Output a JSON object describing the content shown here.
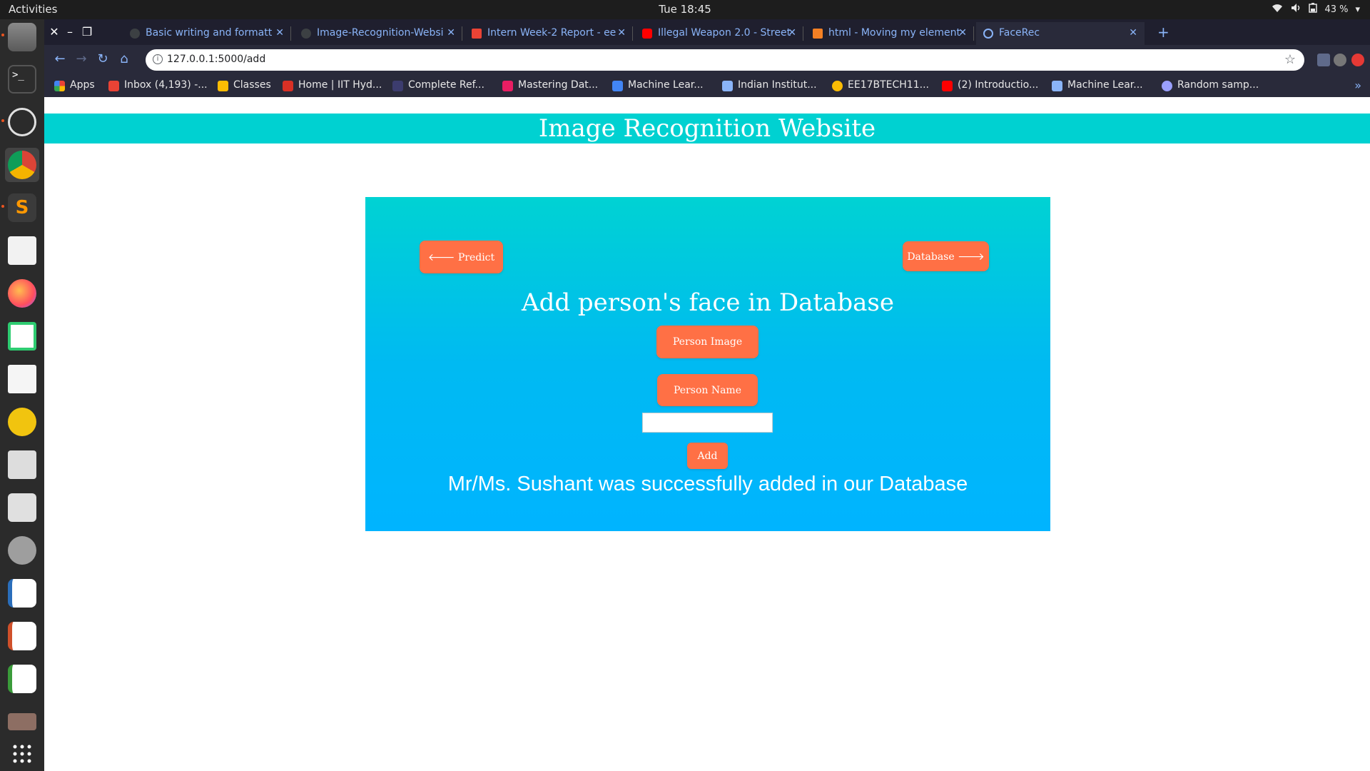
{
  "system": {
    "activities": "Activities",
    "clock": "Tue 18:45",
    "battery": "43 %"
  },
  "tabs": [
    {
      "title": "Basic writing and formatt",
      "icon_color": "#3c4043"
    },
    {
      "title": "Image-Recognition-Websi",
      "icon_color": "#3c4043"
    },
    {
      "title": "Intern Week-2 Report - ee",
      "icon_color": "#ea4335"
    },
    {
      "title": "Illegal Weapon 2.0 - Street",
      "icon_color": "#ff0000"
    },
    {
      "title": "html - Moving my element",
      "icon_color": "#f48024"
    },
    {
      "title": "FaceRec",
      "icon_color": "#8ab4f8"
    }
  ],
  "toolbar": {
    "url": "127.0.0.1:5000/add"
  },
  "bookmarks": [
    {
      "label": "Apps",
      "icon_color": "#ea4335"
    },
    {
      "label": "Inbox (4,193) -...",
      "icon_color": "#ea4335"
    },
    {
      "label": "Classes",
      "icon_color": "#fbbc04"
    },
    {
      "label": "Home | IIT Hyd...",
      "icon_color": "#d93025"
    },
    {
      "label": "Complete Ref...",
      "icon_color": "#3c3c6e"
    },
    {
      "label": "Mastering Dat...",
      "icon_color": "#e91e63"
    },
    {
      "label": "Machine Lear...",
      "icon_color": "#4285f4"
    },
    {
      "label": "Indian Institut...",
      "icon_color": "#8ab4f8"
    },
    {
      "label": "EE17BTECH11...",
      "icon_color": "#fbbc04"
    },
    {
      "label": "(2) Introductio...",
      "icon_color": "#ff0000"
    },
    {
      "label": "Machine Lear...",
      "icon_color": "#8ab4f8"
    },
    {
      "label": "Random samp...",
      "icon_color": "#9aa0ff"
    }
  ],
  "page": {
    "header": "Image Recognition Website",
    "predict_label": "🡐 Predict",
    "database_label": "Database 🡒",
    "title": "Add person's face in Database",
    "image_label": "Person Image",
    "name_label": "Person Name",
    "name_value": "",
    "add_label": "Add",
    "success": "Mr/Ms. Sushant was successfully added in our Database"
  },
  "colors": {
    "header_bg": "#00d1d1",
    "button": "#ff7045",
    "card_top": "#00d2d3",
    "card_bottom": "#00b4ff"
  },
  "dock_icons": [
    "files-icon",
    "terminal-icon",
    "network-icon",
    "chrome-icon",
    "sublime-icon",
    "evince-icon",
    "firefox-icon",
    "gnome-shell-icon",
    "text-editor-icon",
    "teapot-icon",
    "image-viewer-icon",
    "software-icon",
    "settings-icon",
    "writer-icon",
    "impress-icon",
    "calc-icon",
    "archive-icon",
    "apps-grid-icon"
  ]
}
